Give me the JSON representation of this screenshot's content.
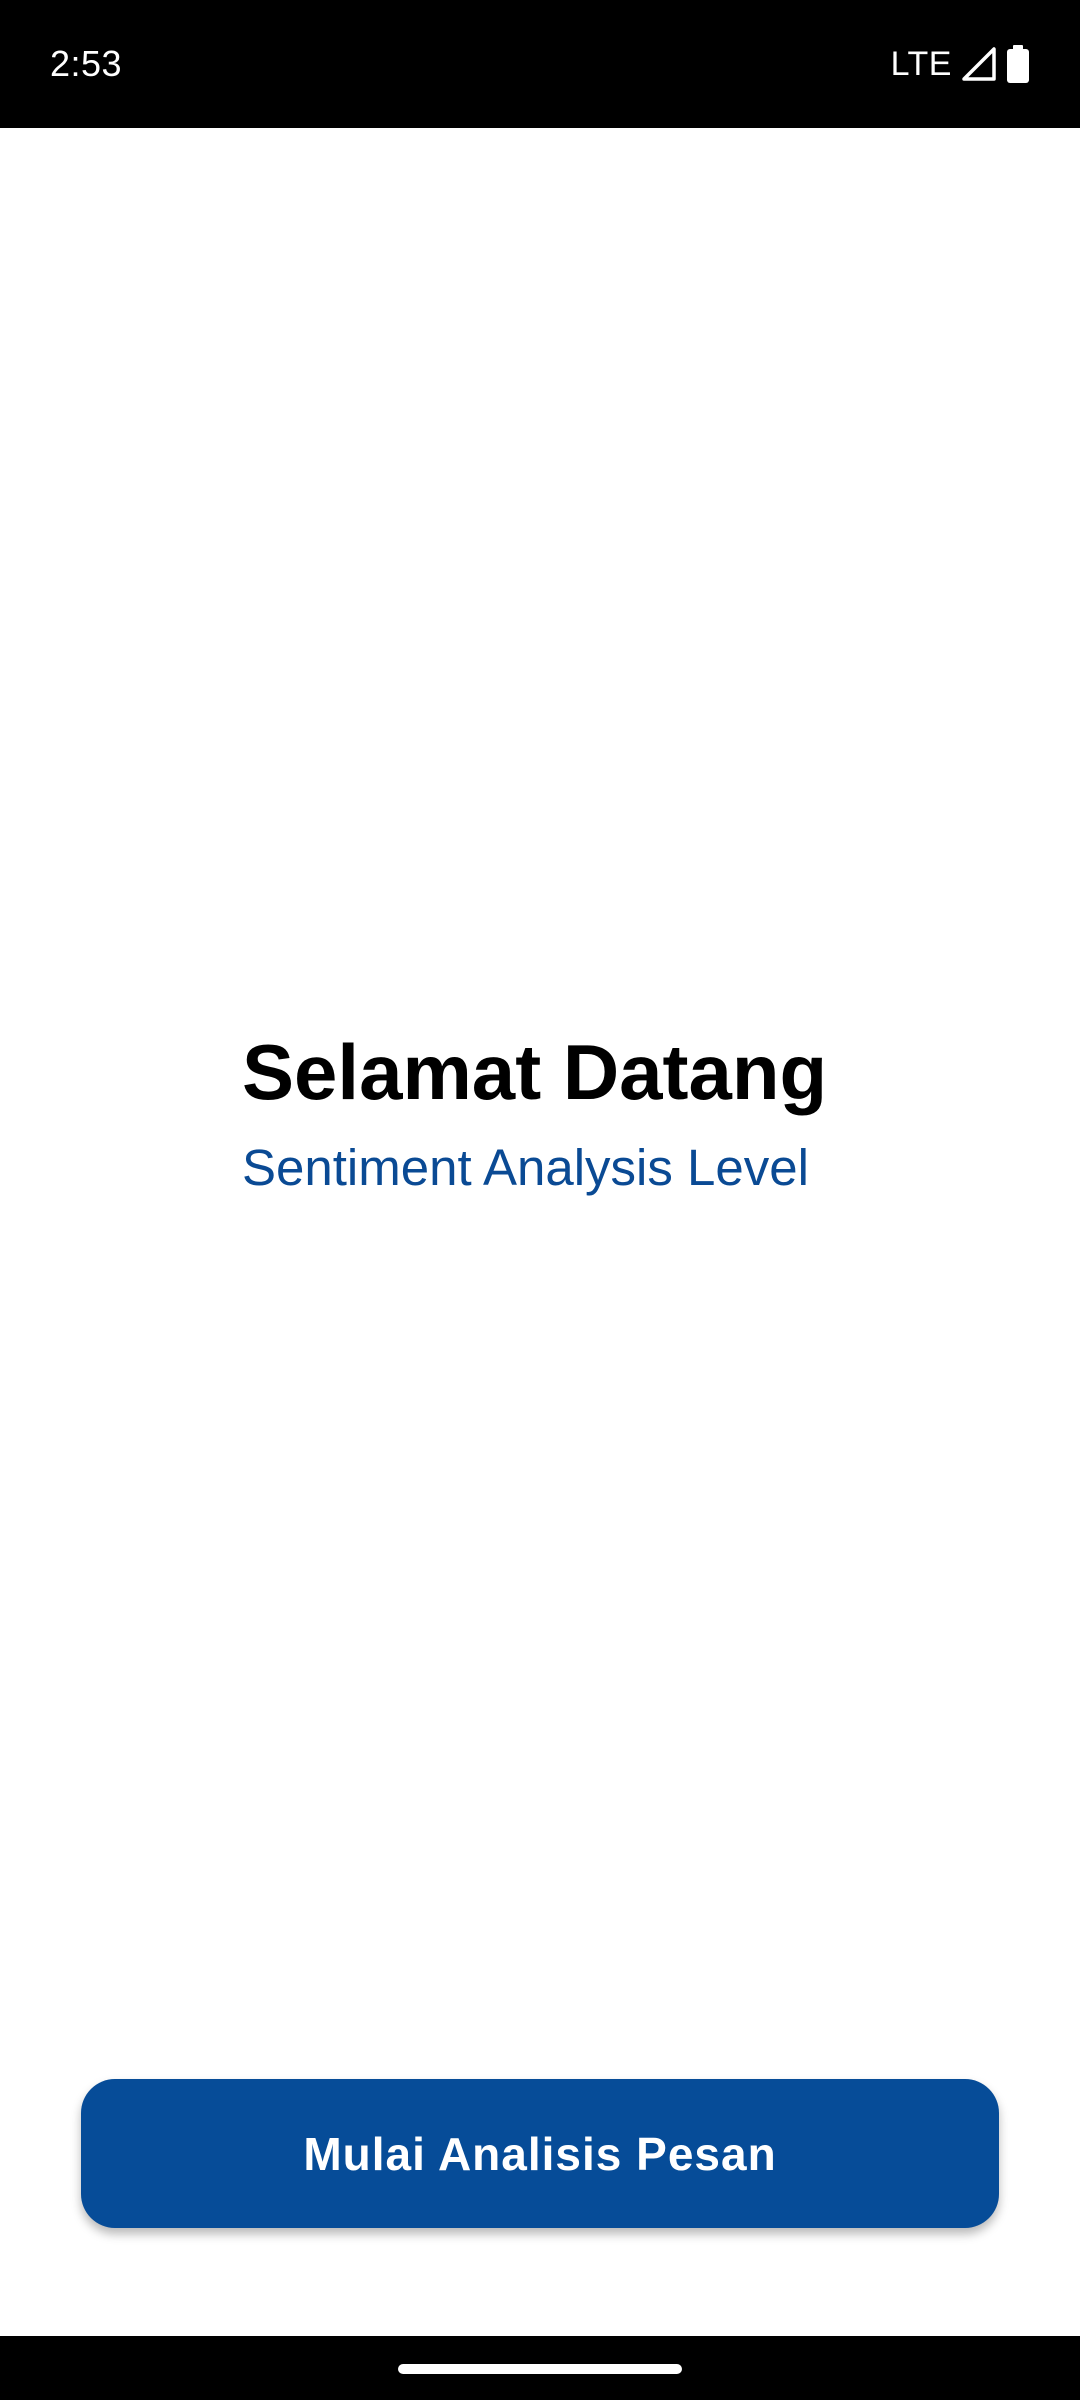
{
  "status_bar": {
    "time": "2:53",
    "network": "LTE",
    "icons": [
      "signal-icon",
      "battery-icon"
    ]
  },
  "welcome": {
    "title": "Selamat Datang",
    "subtitle": "Sentiment Analysis Level"
  },
  "actions": {
    "start_button_label": "Mulai Analisis Pesan"
  },
  "colors": {
    "accent": "#064C98",
    "subtitle": "#0A4A94",
    "status_bar_bg": "#000000",
    "background": "#FFFFFF"
  }
}
